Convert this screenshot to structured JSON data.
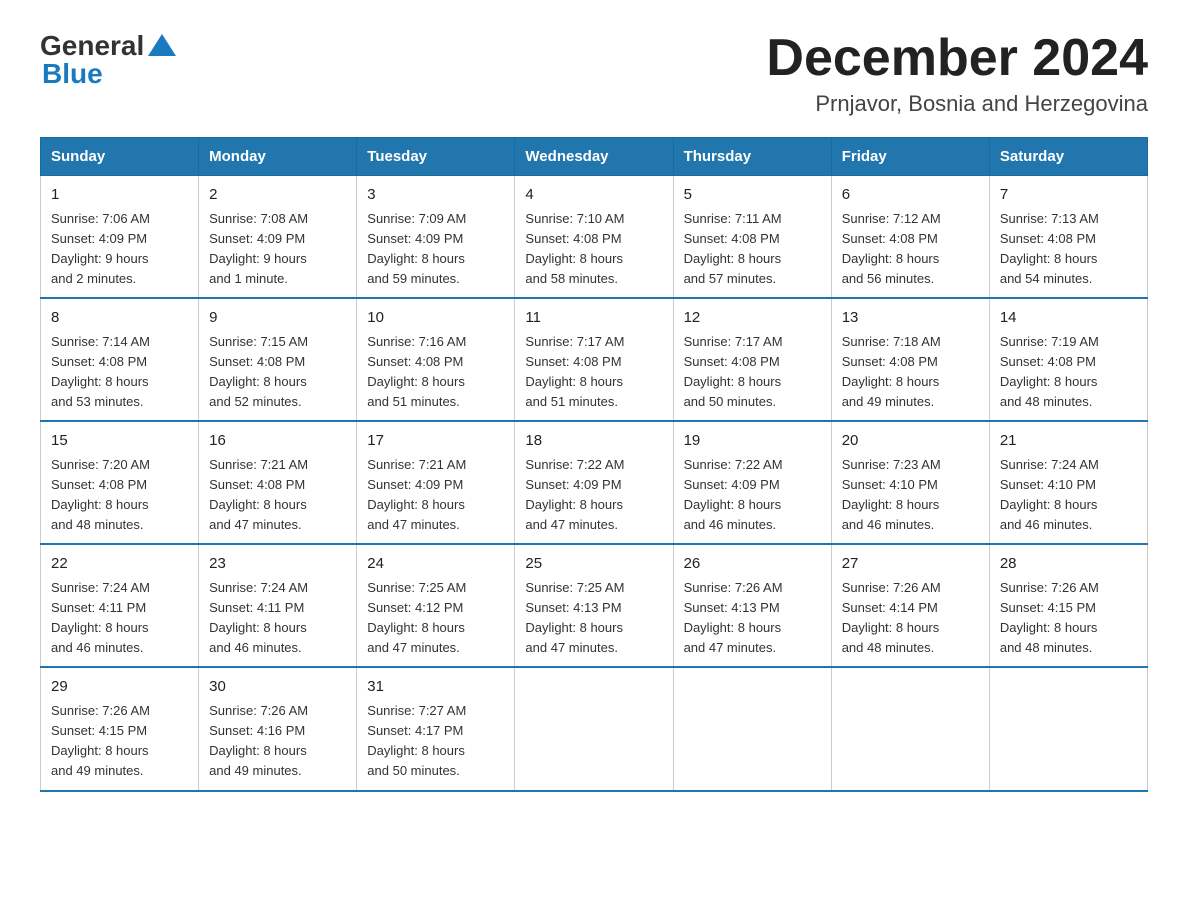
{
  "logo": {
    "general": "General",
    "blue": "Blue"
  },
  "title": "December 2024",
  "subtitle": "Prnjavor, Bosnia and Herzegovina",
  "days_of_week": [
    "Sunday",
    "Monday",
    "Tuesday",
    "Wednesday",
    "Thursday",
    "Friday",
    "Saturday"
  ],
  "weeks": [
    [
      {
        "day": "1",
        "info": "Sunrise: 7:06 AM\nSunset: 4:09 PM\nDaylight: 9 hours\nand 2 minutes."
      },
      {
        "day": "2",
        "info": "Sunrise: 7:08 AM\nSunset: 4:09 PM\nDaylight: 9 hours\nand 1 minute."
      },
      {
        "day": "3",
        "info": "Sunrise: 7:09 AM\nSunset: 4:09 PM\nDaylight: 8 hours\nand 59 minutes."
      },
      {
        "day": "4",
        "info": "Sunrise: 7:10 AM\nSunset: 4:08 PM\nDaylight: 8 hours\nand 58 minutes."
      },
      {
        "day": "5",
        "info": "Sunrise: 7:11 AM\nSunset: 4:08 PM\nDaylight: 8 hours\nand 57 minutes."
      },
      {
        "day": "6",
        "info": "Sunrise: 7:12 AM\nSunset: 4:08 PM\nDaylight: 8 hours\nand 56 minutes."
      },
      {
        "day": "7",
        "info": "Sunrise: 7:13 AM\nSunset: 4:08 PM\nDaylight: 8 hours\nand 54 minutes."
      }
    ],
    [
      {
        "day": "8",
        "info": "Sunrise: 7:14 AM\nSunset: 4:08 PM\nDaylight: 8 hours\nand 53 minutes."
      },
      {
        "day": "9",
        "info": "Sunrise: 7:15 AM\nSunset: 4:08 PM\nDaylight: 8 hours\nand 52 minutes."
      },
      {
        "day": "10",
        "info": "Sunrise: 7:16 AM\nSunset: 4:08 PM\nDaylight: 8 hours\nand 51 minutes."
      },
      {
        "day": "11",
        "info": "Sunrise: 7:17 AM\nSunset: 4:08 PM\nDaylight: 8 hours\nand 51 minutes."
      },
      {
        "day": "12",
        "info": "Sunrise: 7:17 AM\nSunset: 4:08 PM\nDaylight: 8 hours\nand 50 minutes."
      },
      {
        "day": "13",
        "info": "Sunrise: 7:18 AM\nSunset: 4:08 PM\nDaylight: 8 hours\nand 49 minutes."
      },
      {
        "day": "14",
        "info": "Sunrise: 7:19 AM\nSunset: 4:08 PM\nDaylight: 8 hours\nand 48 minutes."
      }
    ],
    [
      {
        "day": "15",
        "info": "Sunrise: 7:20 AM\nSunset: 4:08 PM\nDaylight: 8 hours\nand 48 minutes."
      },
      {
        "day": "16",
        "info": "Sunrise: 7:21 AM\nSunset: 4:08 PM\nDaylight: 8 hours\nand 47 minutes."
      },
      {
        "day": "17",
        "info": "Sunrise: 7:21 AM\nSunset: 4:09 PM\nDaylight: 8 hours\nand 47 minutes."
      },
      {
        "day": "18",
        "info": "Sunrise: 7:22 AM\nSunset: 4:09 PM\nDaylight: 8 hours\nand 47 minutes."
      },
      {
        "day": "19",
        "info": "Sunrise: 7:22 AM\nSunset: 4:09 PM\nDaylight: 8 hours\nand 46 minutes."
      },
      {
        "day": "20",
        "info": "Sunrise: 7:23 AM\nSunset: 4:10 PM\nDaylight: 8 hours\nand 46 minutes."
      },
      {
        "day": "21",
        "info": "Sunrise: 7:24 AM\nSunset: 4:10 PM\nDaylight: 8 hours\nand 46 minutes."
      }
    ],
    [
      {
        "day": "22",
        "info": "Sunrise: 7:24 AM\nSunset: 4:11 PM\nDaylight: 8 hours\nand 46 minutes."
      },
      {
        "day": "23",
        "info": "Sunrise: 7:24 AM\nSunset: 4:11 PM\nDaylight: 8 hours\nand 46 minutes."
      },
      {
        "day": "24",
        "info": "Sunrise: 7:25 AM\nSunset: 4:12 PM\nDaylight: 8 hours\nand 47 minutes."
      },
      {
        "day": "25",
        "info": "Sunrise: 7:25 AM\nSunset: 4:13 PM\nDaylight: 8 hours\nand 47 minutes."
      },
      {
        "day": "26",
        "info": "Sunrise: 7:26 AM\nSunset: 4:13 PM\nDaylight: 8 hours\nand 47 minutes."
      },
      {
        "day": "27",
        "info": "Sunrise: 7:26 AM\nSunset: 4:14 PM\nDaylight: 8 hours\nand 48 minutes."
      },
      {
        "day": "28",
        "info": "Sunrise: 7:26 AM\nSunset: 4:15 PM\nDaylight: 8 hours\nand 48 minutes."
      }
    ],
    [
      {
        "day": "29",
        "info": "Sunrise: 7:26 AM\nSunset: 4:15 PM\nDaylight: 8 hours\nand 49 minutes."
      },
      {
        "day": "30",
        "info": "Sunrise: 7:26 AM\nSunset: 4:16 PM\nDaylight: 8 hours\nand 49 minutes."
      },
      {
        "day": "31",
        "info": "Sunrise: 7:27 AM\nSunset: 4:17 PM\nDaylight: 8 hours\nand 50 minutes."
      },
      null,
      null,
      null,
      null
    ]
  ]
}
